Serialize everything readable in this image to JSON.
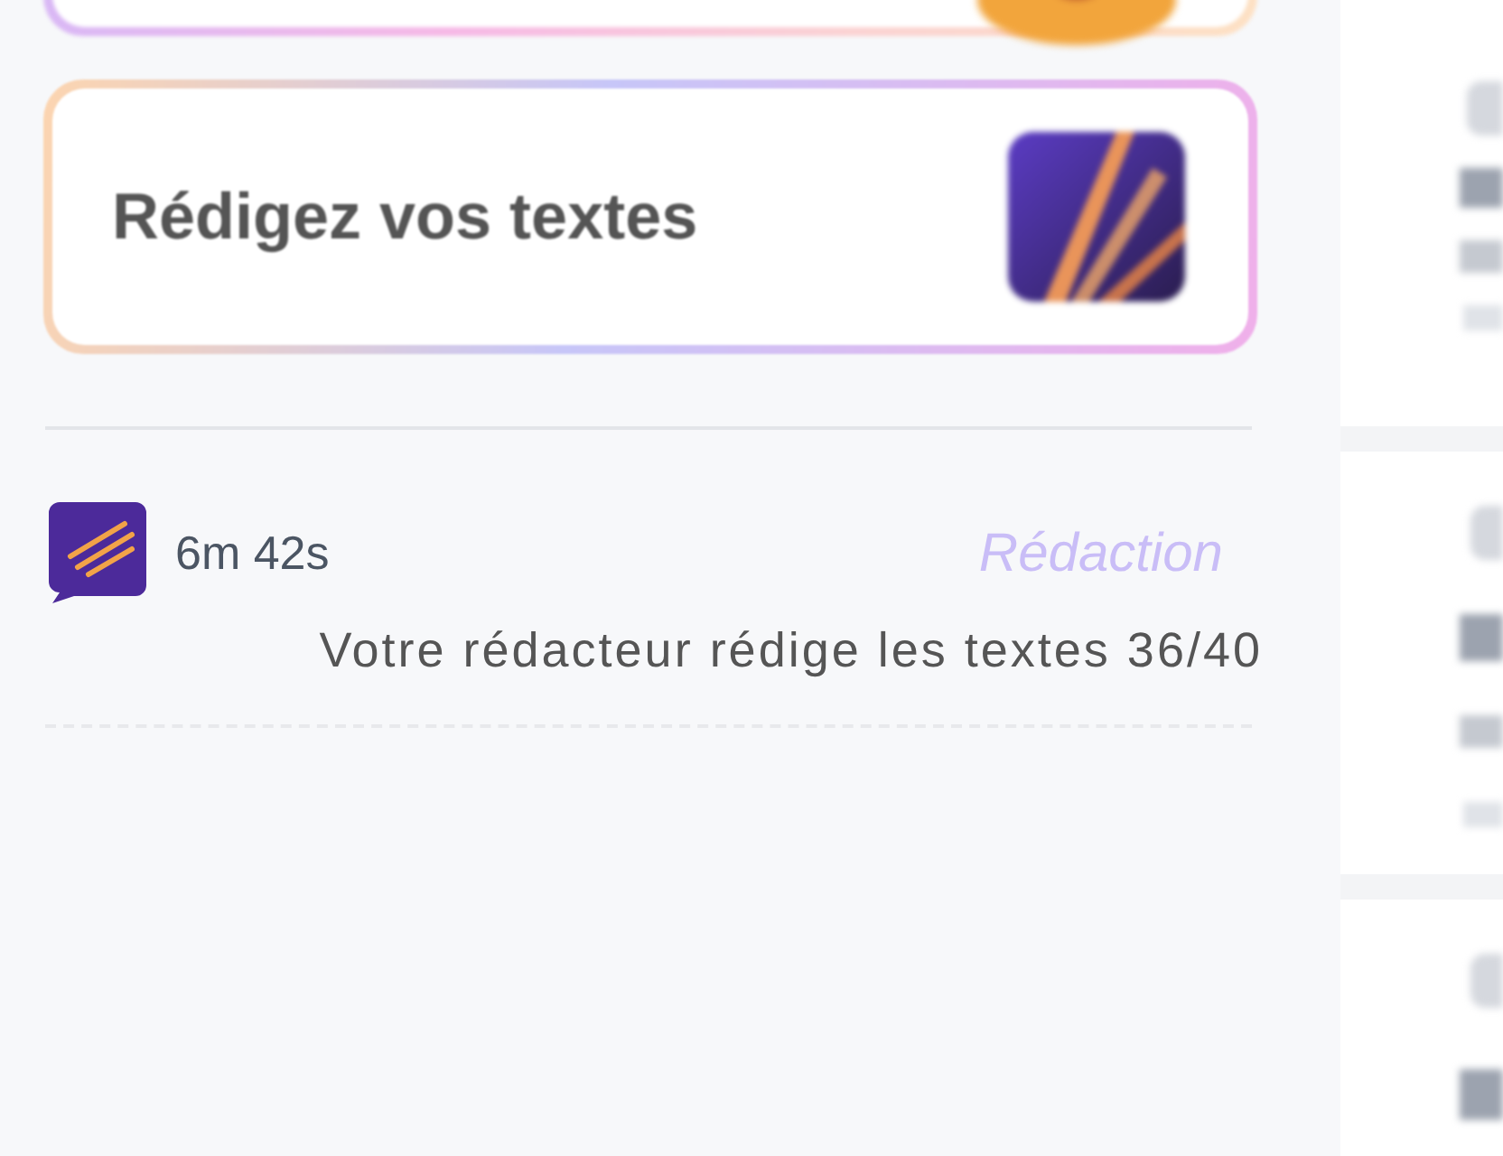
{
  "prompt_card": {
    "title": "Rédigez vos textes"
  },
  "activity": {
    "duration": "6m 42s",
    "stage": "Rédaction",
    "message": "Votre rédacteur rédige les textes 36/40"
  }
}
